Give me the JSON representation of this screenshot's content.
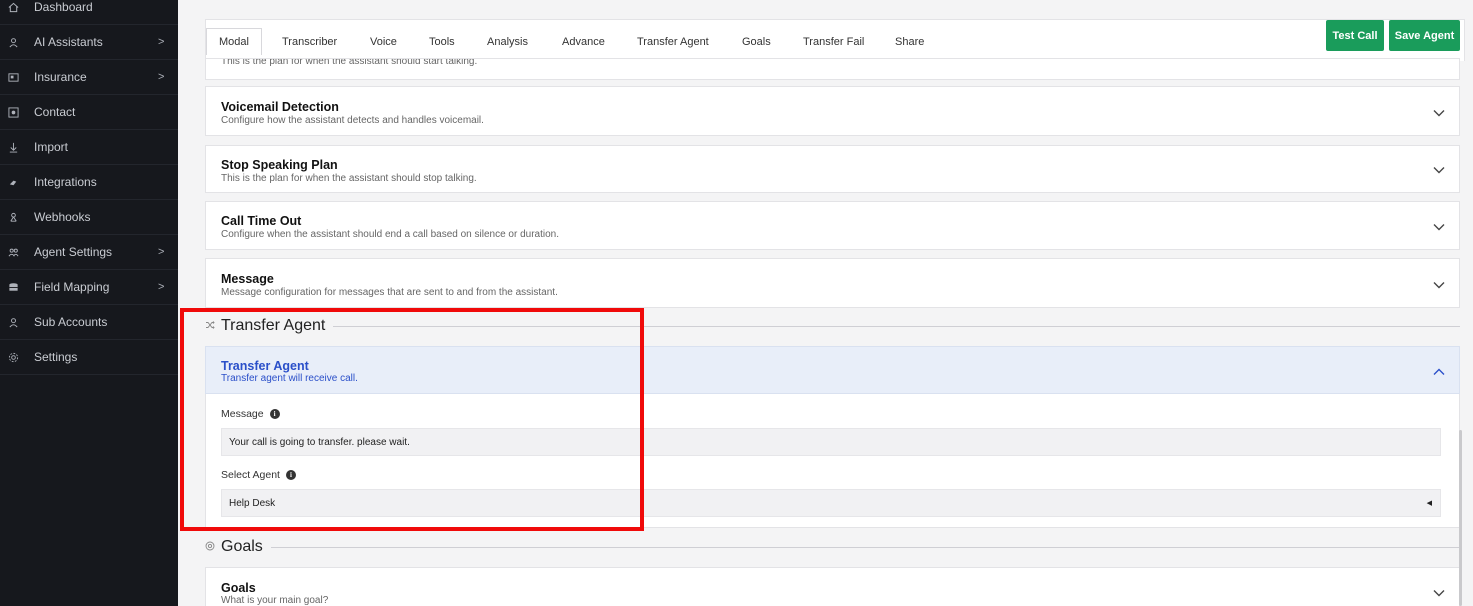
{
  "sidebar": {
    "items": [
      {
        "label": "Dashboard",
        "icon": "home-icon",
        "chevron": false
      },
      {
        "label": "AI Assistants",
        "icon": "user-icon",
        "chevron": true
      },
      {
        "label": "Insurance",
        "icon": "id-card-icon",
        "chevron": true
      },
      {
        "label": "Contact",
        "icon": "contact-icon",
        "chevron": false
      },
      {
        "label": "Import",
        "icon": "import-icon",
        "chevron": false
      },
      {
        "label": "Integrations",
        "icon": "plug-icon",
        "chevron": false
      },
      {
        "label": "Webhooks",
        "icon": "webhook-icon",
        "chevron": false
      },
      {
        "label": "Agent Settings",
        "icon": "users-icon",
        "chevron": true
      },
      {
        "label": "Field Mapping",
        "icon": "database-icon",
        "chevron": true
      },
      {
        "label": "Sub Accounts",
        "icon": "user-icon",
        "chevron": false
      },
      {
        "label": "Settings",
        "icon": "gear-icon",
        "chevron": false
      }
    ],
    "chevron_glyph": ">"
  },
  "tabs": [
    "Modal",
    "Transcriber",
    "Voice",
    "Tools",
    "Analysis",
    "Advance",
    "Transfer Agent",
    "Goals",
    "Transfer Fail",
    "Share"
  ],
  "actions": {
    "test_call": "Test Call",
    "save_agent": "Save Agent"
  },
  "panels": {
    "top_partial_desc": "This is the plan for when the assistant should start talking.",
    "voicemail": {
      "title": "Voicemail Detection",
      "desc": "Configure how the assistant detects and handles voicemail."
    },
    "stop_speaking": {
      "title": "Stop Speaking Plan",
      "desc": "This is the plan for when the assistant should stop talking."
    },
    "call_timeout": {
      "title": "Call Time Out",
      "desc": "Configure when the assistant should end a call based on silence or duration."
    },
    "message": {
      "title": "Message",
      "desc": "Message configuration for messages that are sent to and from the assistant."
    }
  },
  "transfer_section": {
    "heading": "Transfer Agent",
    "panel_title": "Transfer Agent",
    "panel_desc": "Transfer agent will receive call.",
    "message_label": "Message",
    "message_value": "Your call is going to transfer. please wait.",
    "select_label": "Select Agent",
    "select_value": "Help Desk"
  },
  "goals_section": {
    "heading": "Goals",
    "panel_title": "Goals",
    "panel_desc": "What is your main goal?"
  },
  "colors": {
    "sidebar_bg": "#16181d",
    "accent_green": "#1a9c5b",
    "highlight_red": "#f00a0a",
    "expanded_blue": "#e8eef9",
    "title_blue": "#2a4fc9"
  }
}
